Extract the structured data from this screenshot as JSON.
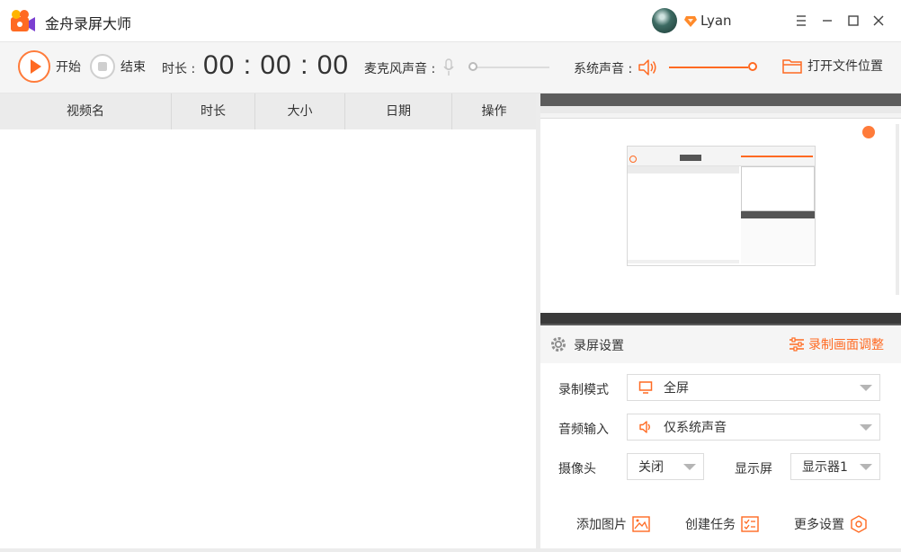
{
  "app": {
    "title": "金舟录屏大师"
  },
  "user": {
    "name": "Lyan"
  },
  "toolbar": {
    "start_label": "开始",
    "stop_label": "结束",
    "duration_label": "时长 :",
    "duration_value": "00 : 00 : 00",
    "mic_label": "麦克风声音 :",
    "mic_volume_pct": 0,
    "system_label": "系统声音 :",
    "system_volume_pct": 100,
    "open_folder_label": "打开文件位置"
  },
  "table": {
    "columns": [
      "视频名",
      "时长",
      "大小",
      "日期",
      "操作"
    ],
    "rows": []
  },
  "settings": {
    "title": "录屏设置",
    "adjust_label": "录制画面调整",
    "record_mode_label": "录制模式",
    "record_mode_value": "全屏",
    "audio_input_label": "音频输入",
    "audio_input_value": "仅系统声音",
    "camera_label": "摄像头",
    "camera_value": "关闭",
    "display_label": "显示屏",
    "display_value": "显示器1"
  },
  "footer": {
    "add_image_label": "添加图片",
    "create_task_label": "创建任务",
    "more_settings_label": "更多设置"
  },
  "colors": {
    "accent": "#ff6a22",
    "header_bg": "#ebebeb",
    "toolbar_bg": "#f5f5f5"
  }
}
